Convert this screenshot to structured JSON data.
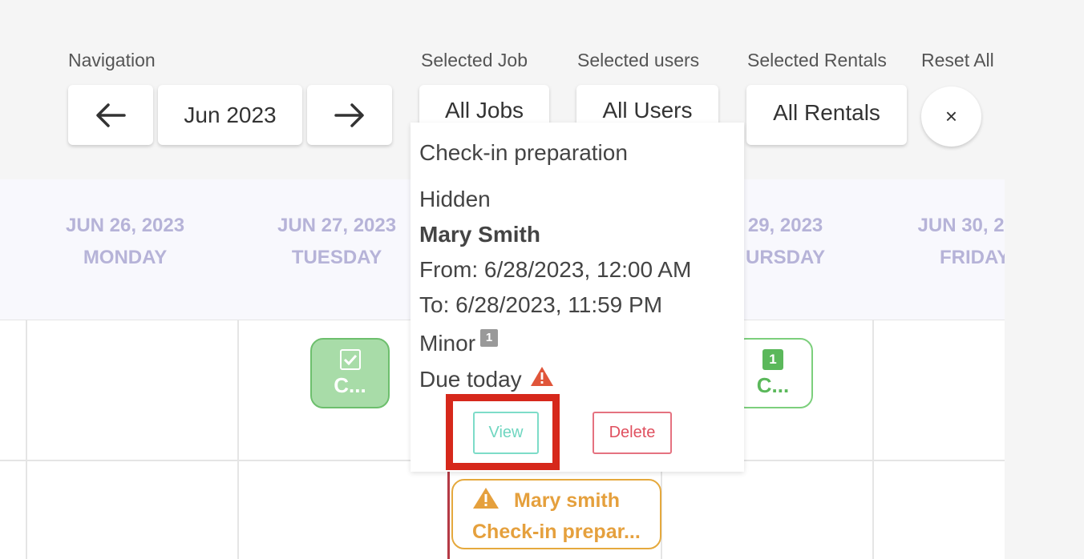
{
  "toolbar": {
    "navigation_label": "Navigation",
    "current_month": "Jun 2023",
    "selected_job_label": "Selected Job",
    "selected_job_value": "All Jobs",
    "selected_users_label": "Selected users",
    "selected_users_value": "All Users",
    "selected_rentals_label": "Selected Rentals",
    "selected_rentals_value": "All Rentals",
    "reset_label": "Reset All",
    "reset_symbol": "×"
  },
  "calendar": {
    "days": [
      {
        "date": "JUN 26, 2023",
        "weekday": "MONDAY"
      },
      {
        "date": "JUN 27, 2023",
        "weekday": "TUESDAY"
      },
      {
        "date": "29, 2023",
        "weekday": "URSDAY"
      },
      {
        "date": "JUN 30, 2",
        "weekday": "FRIDAY"
      }
    ],
    "events": {
      "tuesday_event_text": "C...",
      "thursday_event_badge": "1",
      "thursday_event_text": "C...",
      "warning_event_name": "Mary smith",
      "warning_event_title": "Check-in prepar..."
    }
  },
  "popover": {
    "title": "Check-in preparation",
    "visibility": "Hidden",
    "assignee": "Mary Smith",
    "from": "From: 6/28/2023, 12:00 AM",
    "to": "To: 6/28/2023, 11:59 PM",
    "severity": "Minor",
    "severity_badge": "1",
    "due": "Due today",
    "view_label": "View",
    "delete_label": "Delete"
  },
  "colors": {
    "accent_header": "#b6b3d8",
    "done_event": "#a8dca8",
    "warning": "#e5a03d",
    "highlight": "#d6281b"
  }
}
